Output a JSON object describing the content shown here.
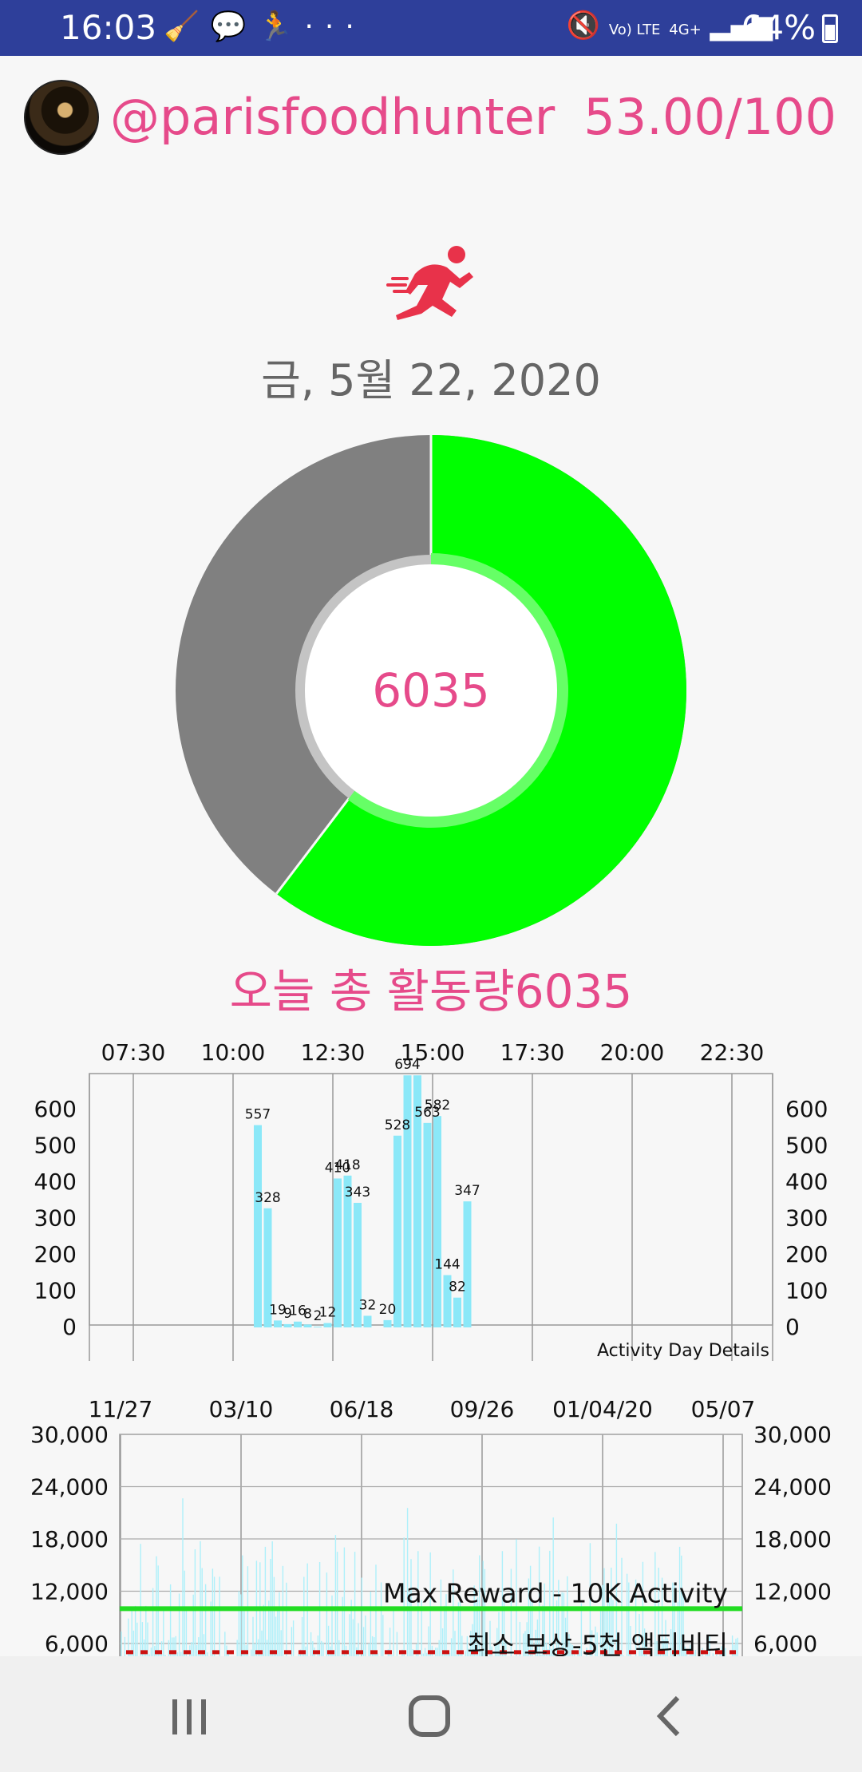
{
  "status_bar": {
    "time": "16:03",
    "left_icons": [
      "cleaner-icon",
      "messenger-icon",
      "runner-notification-icon",
      "more-dots-icon"
    ],
    "right_icons": [
      "mute-icon",
      "volte-icon",
      "4g-icon",
      "signal-icon"
    ],
    "battery": "64%"
  },
  "header": {
    "username": "@parisfoodhunter",
    "score": "53.00/100"
  },
  "date": "금, 5월 22, 2020",
  "donut": {
    "value": "6035",
    "fraction": 0.6035,
    "colors": {
      "progress": "#00ff00",
      "remaining": "#808080",
      "inner_ring": "#66ff66"
    }
  },
  "total_label": "오늘 총 활동량6035",
  "chart1": {
    "type": "bar",
    "x_ticks": [
      "07:30",
      "10:00",
      "12:30",
      "15:00",
      "17:30",
      "20:00",
      "22:30"
    ],
    "y_ticks": [
      "0",
      "100",
      "200",
      "300",
      "400",
      "500",
      "600"
    ],
    "caption": "Activity Day Details",
    "bar_color": "#8be8f8",
    "chart_data": {
      "type": "bar",
      "ylim": [
        0,
        700
      ],
      "bars": [
        {
          "time": "10:30",
          "value": 557
        },
        {
          "time": "10:45",
          "value": 328
        },
        {
          "time": "11:00",
          "value": 19
        },
        {
          "time": "11:15",
          "value": 9
        },
        {
          "time": "11:30",
          "value": 16
        },
        {
          "time": "11:45",
          "value": 8
        },
        {
          "time": "12:00",
          "value": 2
        },
        {
          "time": "12:15",
          "value": 12
        },
        {
          "time": "12:30",
          "value": 410
        },
        {
          "time": "12:45",
          "value": 418
        },
        {
          "time": "13:00",
          "value": 343
        },
        {
          "time": "13:15",
          "value": 32
        },
        {
          "time": "13:45",
          "value": 20
        },
        {
          "time": "14:00",
          "value": 528
        },
        {
          "time": "14:15",
          "value": 694
        },
        {
          "time": "14:30",
          "value": 694
        },
        {
          "time": "14:45",
          "value": 563
        },
        {
          "time": "15:00",
          "value": 582
        },
        {
          "time": "15:15",
          "value": 144
        },
        {
          "time": "15:30",
          "value": 82
        },
        {
          "time": "15:45",
          "value": 347
        }
      ]
    },
    "bar_labels": [
      "557",
      "328",
      "19",
      "9",
      "16",
      "8",
      "2",
      "12",
      "410",
      "418",
      "343",
      "32",
      "20",
      "528",
      "694",
      "563",
      "582",
      "144",
      "82",
      "347"
    ]
  },
  "chart2": {
    "type": "bar",
    "x_ticks": [
      "11/27",
      "03/10",
      "06/18",
      "09/26",
      "01/04/20",
      "05/07"
    ],
    "y_ticks": [
      "6,000",
      "12,000",
      "18,000",
      "24,000",
      "30,000"
    ],
    "max_reward_label": "Max Reward - 10K Activity",
    "min_reward_label": "최소 보상-5천 액티비티",
    "max_reward_value": 10000,
    "min_reward_value": 5000,
    "colors": {
      "bars": "#aef0fa",
      "max_line": "#22dd22",
      "min_line": "#cc1111"
    },
    "chart_data": {
      "type": "bar",
      "ylim": [
        6000,
        30000
      ],
      "x_range": [
        "11/27",
        "05/22"
      ],
      "note_lines": [
        {
          "label": "Max Reward - 10K Activity",
          "y": 10000
        },
        {
          "label": "최소 보상-5천 액티비티",
          "y": 5000
        }
      ]
    }
  },
  "navbar": {
    "buttons": [
      "recents-icon",
      "home-icon",
      "back-icon"
    ]
  }
}
